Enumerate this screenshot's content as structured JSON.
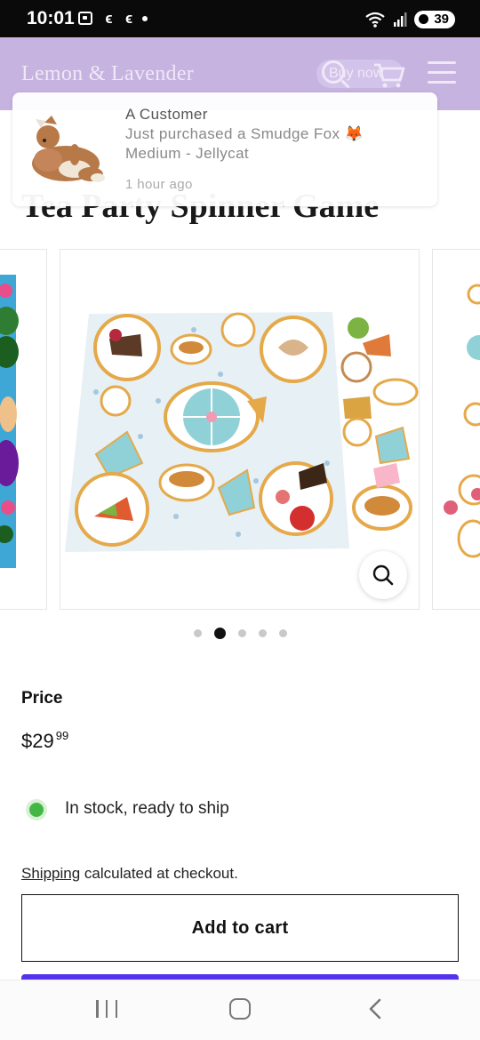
{
  "status_bar": {
    "time": "10:01",
    "battery": "39",
    "icons": [
      "gallery-icon",
      "drop-icon",
      "drop-icon",
      "dot-icon",
      "wifi-icon",
      "signal-icon",
      "battery-icon"
    ]
  },
  "header": {
    "logo": "Lemon & Lavender",
    "buy_now": "Buy now",
    "background": "#c6b3e0"
  },
  "toast": {
    "title": "A Customer",
    "message_line1": "Just purchased a Smudge Fox 🦊",
    "message_line2": "Medium - Jellycat",
    "time": "1 hour ago"
  },
  "product": {
    "title": "Tea Party Spinner Game",
    "price_label": "Price",
    "price_main": "$29",
    "price_cents": "99",
    "stock_text": "In stock, ready to ship",
    "stock_color": "#43b743",
    "shipping_link": "Shipping",
    "shipping_text": " calculated at checkout.",
    "add_to_cart": "Add to cart",
    "buy_button_color": "#5433eb"
  },
  "carousel": {
    "slide_count": 5,
    "active_index": 1
  }
}
